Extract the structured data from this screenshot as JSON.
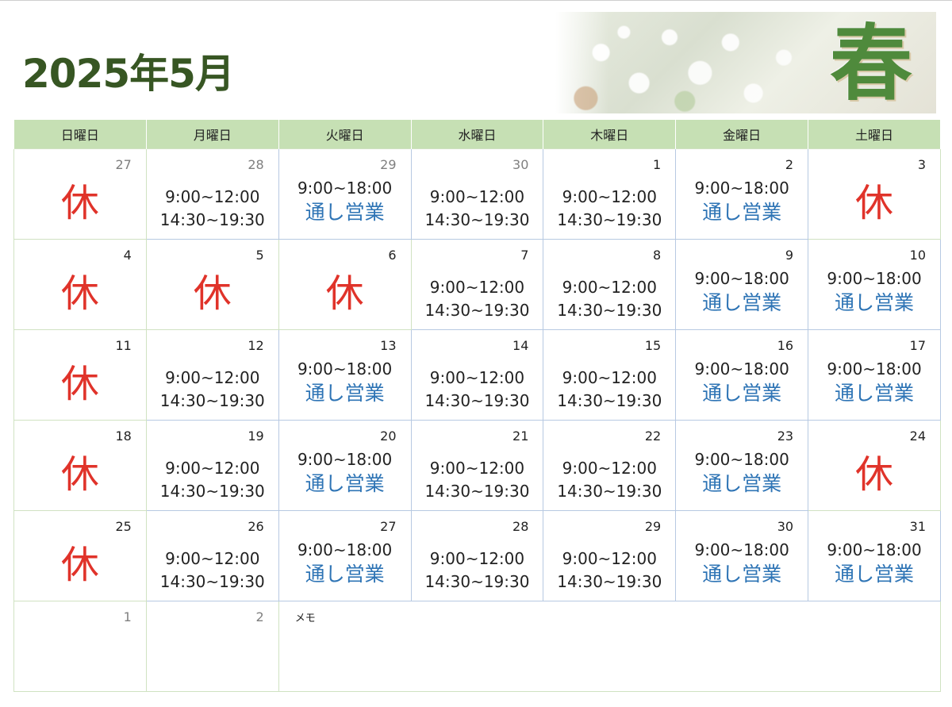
{
  "header": {
    "title": "2025年5月",
    "banner_char": "春"
  },
  "weekdays": [
    "日曜日",
    "月曜日",
    "火曜日",
    "水曜日",
    "木曜日",
    "金曜日",
    "土曜日"
  ],
  "labels": {
    "closed": "休",
    "split_am": "9:00~12:00",
    "split_pm": "14:30~19:30",
    "full_hours": "9:00~18:00",
    "full_label": "通し営業",
    "memo": "メモ"
  },
  "weeks": [
    [
      {
        "day": "27",
        "type": "closed",
        "other": true
      },
      {
        "day": "28",
        "type": "split",
        "other": true
      },
      {
        "day": "29",
        "type": "full",
        "other": true
      },
      {
        "day": "30",
        "type": "split",
        "other": true
      },
      {
        "day": "1",
        "type": "split"
      },
      {
        "day": "2",
        "type": "full"
      },
      {
        "day": "3",
        "type": "closed"
      }
    ],
    [
      {
        "day": "4",
        "type": "closed"
      },
      {
        "day": "5",
        "type": "closed"
      },
      {
        "day": "6",
        "type": "closed"
      },
      {
        "day": "7",
        "type": "split"
      },
      {
        "day": "8",
        "type": "split"
      },
      {
        "day": "9",
        "type": "full"
      },
      {
        "day": "10",
        "type": "full"
      }
    ],
    [
      {
        "day": "11",
        "type": "closed"
      },
      {
        "day": "12",
        "type": "split"
      },
      {
        "day": "13",
        "type": "full"
      },
      {
        "day": "14",
        "type": "split"
      },
      {
        "day": "15",
        "type": "split"
      },
      {
        "day": "16",
        "type": "full"
      },
      {
        "day": "17",
        "type": "full"
      }
    ],
    [
      {
        "day": "18",
        "type": "closed"
      },
      {
        "day": "19",
        "type": "split"
      },
      {
        "day": "20",
        "type": "full"
      },
      {
        "day": "21",
        "type": "split"
      },
      {
        "day": "22",
        "type": "split"
      },
      {
        "day": "23",
        "type": "full"
      },
      {
        "day": "24",
        "type": "closed"
      }
    ],
    [
      {
        "day": "25",
        "type": "closed"
      },
      {
        "day": "26",
        "type": "split"
      },
      {
        "day": "27",
        "type": "full"
      },
      {
        "day": "28",
        "type": "split"
      },
      {
        "day": "29",
        "type": "split"
      },
      {
        "day": "30",
        "type": "full"
      },
      {
        "day": "31",
        "type": "full"
      }
    ]
  ],
  "last_row": [
    {
      "day": "1",
      "other": true
    },
    {
      "day": "2",
      "other": true
    }
  ],
  "colors": {
    "title": "#375623",
    "header_bg": "#c6e0b4",
    "closed": "#e0332a",
    "full_label": "#2e74b5"
  }
}
